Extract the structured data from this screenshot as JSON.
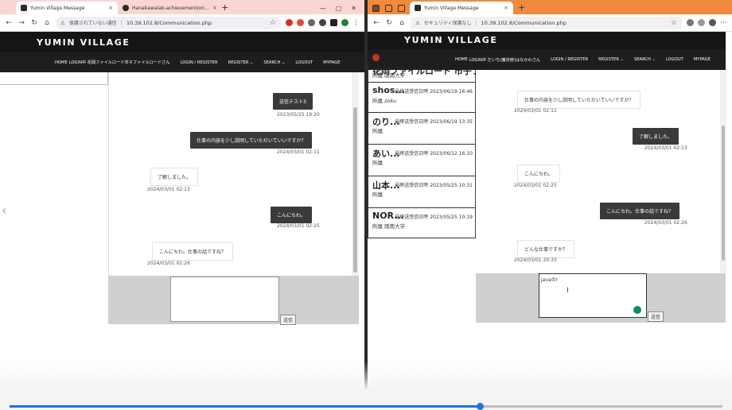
{
  "left_window": {
    "tabs": [
      {
        "title": "Yumin Village Message"
      },
      {
        "title": "Hanakawalab-achievement/on..."
      }
    ],
    "address": {
      "security": "保護されていない通信",
      "url": "10.39.102.8/Communication.php"
    },
    "site": {
      "brand": "YUMIN VILLAGE",
      "menu": [
        "HOME",
        "LOGIN中 花岡ファイルロード市子ファイルロードさん",
        "LOGIN / REGISTER",
        "REGISTER",
        "SEARCH",
        "LOGOUT",
        "MYPAGE"
      ]
    },
    "messages": [
      {
        "side": "sent",
        "text": "送信テスト3",
        "time": "2023/05/25 19:20"
      },
      {
        "side": "sent",
        "text": "仕事の内容を少し説明していただいていいですか？",
        "time": "2024/03/01 02:11"
      },
      {
        "side": "recv",
        "text": "了解しました。",
        "time": "2024/03/01 02:13"
      },
      {
        "side": "sent",
        "text": "こんにちわ。",
        "time": "2024/03/01 02:25"
      },
      {
        "side": "recv",
        "text": "こんにちわ。仕事の話ですね？",
        "time": "2024/03/01 02:26"
      }
    ],
    "send_label": "送信"
  },
  "right_window": {
    "tabs": [
      {
        "title": "Yumin Village Message"
      }
    ],
    "address": {
      "security": "セキュリティ保護なし",
      "url": "10.39.102.8/Communication.php"
    },
    "site": {
      "brand": "YUMIN VILLAGE",
      "menu": [
        "HOME",
        "LOGIN中 だいち(魔法使)はなかわさん",
        "LOGIN / REGISTER",
        "REGISTER",
        "SEARCH",
        "LOGOUT",
        "MYPAGE"
      ]
    },
    "contacts": [
      {
        "name": "花岡ファイルロード 市子ファ...",
        "meta": "",
        "org": "所属 阪南大学"
      },
      {
        "name": "shos...",
        "meta": "最終送受信日時 2023/06/19 16:46",
        "org": "所属 zoku"
      },
      {
        "name": "のり...",
        "meta": "最終送受信日時 2023/06/19 13:35",
        "org": "所属"
      },
      {
        "name": "あい...",
        "meta": "最終送受信日時 2023/06/12 16:10",
        "org": "所属"
      },
      {
        "name": "山本...",
        "meta": "最終送受信日時 2023/05/25 10:31",
        "org": "所属"
      },
      {
        "name": "NOR...",
        "meta": "最終送受信日時 2023/05/25 10:19",
        "org": "所属 阪南大学"
      }
    ],
    "messages": [
      {
        "side": "recv",
        "text": "仕事の内容を少し説明していただいていいですか？",
        "time": "2024/03/01 02:11"
      },
      {
        "side": "sent",
        "text": "了解しました。",
        "time": "2024/03/01 02:13"
      },
      {
        "side": "recv",
        "text": "こんにちわ。",
        "time": "2024/03/01 02:25"
      },
      {
        "side": "sent",
        "text": "こんにちわ。仕事の話ですね？",
        "time": "2024/03/01 02:26"
      },
      {
        "side": "recv",
        "text": "どんな仕事ですか？",
        "time": "2024/03/01 20:33"
      }
    ],
    "input_value": "javaのr",
    "send_label": "送信"
  },
  "video_progress": 0.66,
  "colors": {
    "left_tabbar": "#f9d6d3",
    "right_tabbar": "#f08a3c",
    "header_bg": "#151515",
    "progress": "#1a73e8",
    "badge": "#0e8a6c"
  }
}
